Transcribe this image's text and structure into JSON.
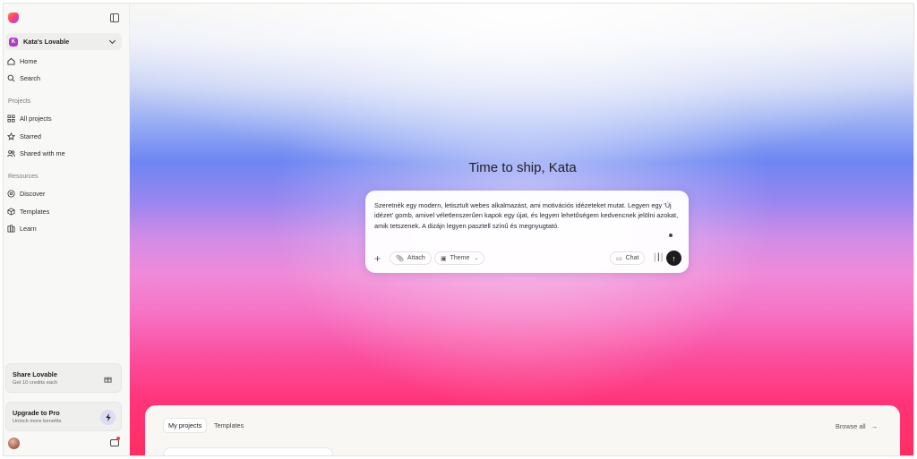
{
  "sidebar": {
    "workspace_initial": "K",
    "workspace_name": "Kata's Lovable",
    "nav": {
      "home": "Home",
      "search": "Search"
    },
    "projects_label": "Projects",
    "projects": {
      "all": "All projects",
      "starred": "Starred",
      "shared": "Shared with me"
    },
    "resources_label": "Resources",
    "resources": {
      "discover": "Discover",
      "templates": "Templates",
      "learn": "Learn"
    },
    "share": {
      "title": "Share Lovable",
      "subtitle": "Get 10 credits each"
    },
    "upgrade": {
      "title": "Upgrade to Pro",
      "subtitle": "Unlock more benefits"
    }
  },
  "main": {
    "headline": "Time to ship, Kata",
    "prompt": {
      "text": "Szeretnék egy modern, letisztult webes alkalmazást, ami motivációs idézeteket mutat. Legyen egy 'Új idézet' gomb, amivel véletlenszerűen kapok egy újat, és legyen lehetőségem kedvencnek jelölni azokat, amik tetszenek. A dizájn legyen pasztell színű és megnyugtató.",
      "attach_label": "Attach",
      "theme_label": "Theme",
      "chat_label": "Chat"
    },
    "panel": {
      "tab_my_projects": "My projects",
      "tab_templates": "Templates",
      "browse_all": "Browse all"
    }
  },
  "colors": {
    "brand_gradient": [
      "#ff8a3d",
      "#ff3b7c",
      "#7b5cff"
    ],
    "workspace_badge": "#b13ac7",
    "send_button": "#1c1c1c",
    "notification_dot": "#ff3a4b"
  },
  "icons": {
    "logo": "lovable-heart-logo",
    "collapse": "sidebar-collapse-icon",
    "home": "home-icon",
    "search": "search-icon",
    "all_projects": "grid-icon",
    "starred": "star-icon",
    "shared": "users-icon",
    "discover": "compass-icon",
    "templates": "cube-icon",
    "learn": "book-icon",
    "share": "gift-icon",
    "upgrade": "bolt-icon",
    "inbox": "inbox-icon",
    "attach": "paperclip-icon",
    "theme": "palette-icon",
    "chat": "chat-icon",
    "voice": "waveform-icon",
    "send": "arrow-up-icon"
  }
}
